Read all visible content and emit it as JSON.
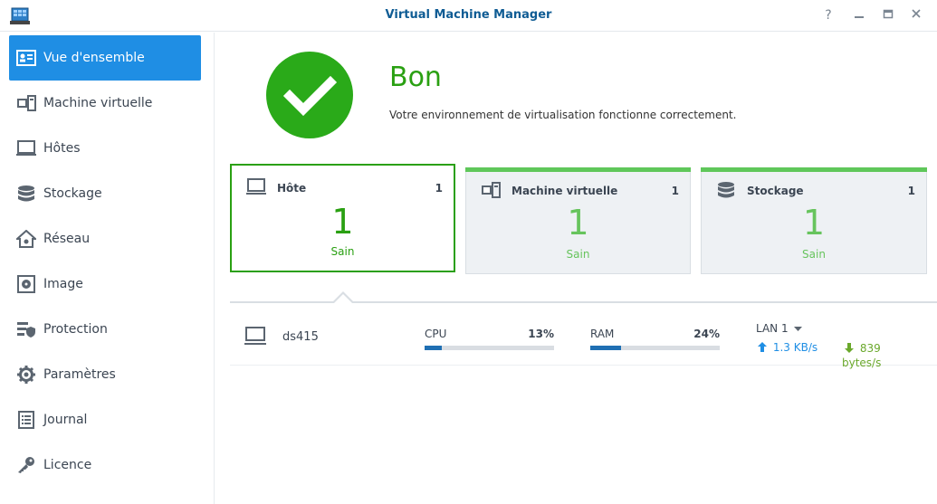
{
  "window": {
    "title": "Virtual Machine Manager",
    "buttons": [
      "?",
      "–",
      "▭",
      "✕"
    ]
  },
  "sidebar": {
    "items": [
      {
        "label": "Vue d'ensemble",
        "icon": "overview-icon",
        "active": true
      },
      {
        "label": "Machine virtuelle",
        "icon": "virtual-machine-icon"
      },
      {
        "label": "Hôtes",
        "icon": "host-icon"
      },
      {
        "label": "Stockage",
        "icon": "storage-icon"
      },
      {
        "label": "Réseau",
        "icon": "network-icon"
      },
      {
        "label": "Image",
        "icon": "image-icon"
      },
      {
        "label": "Protection",
        "icon": "protection-icon"
      },
      {
        "label": "Paramètres",
        "icon": "gear-icon"
      },
      {
        "label": "Journal",
        "icon": "log-icon"
      },
      {
        "label": "Licence",
        "icon": "key-icon"
      }
    ]
  },
  "status": {
    "title": "Bon",
    "description": "Votre environnement de virtualisation fonctionne correctement."
  },
  "cards": [
    {
      "title": "Hôte",
      "count": "1",
      "value": "1",
      "status": "Sain",
      "selected": true
    },
    {
      "title": "Machine virtuelle",
      "count": "1",
      "value": "1",
      "status": "Sain"
    },
    {
      "title": "Stockage",
      "count": "1",
      "value": "1",
      "status": "Sain"
    }
  ],
  "host": {
    "name": "ds415",
    "cpu_label": "CPU",
    "cpu_value": "13%",
    "cpu_fraction": 0.13,
    "ram_label": "RAM",
    "ram_value": "24%",
    "ram_fraction": 0.24,
    "lan_label": "LAN 1",
    "upload": "1.3 KB/s",
    "download": "839 bytes/s"
  },
  "colors": {
    "accent": "#1f8ee4",
    "healthy": "#2aa012",
    "title": "#0f5c94"
  }
}
